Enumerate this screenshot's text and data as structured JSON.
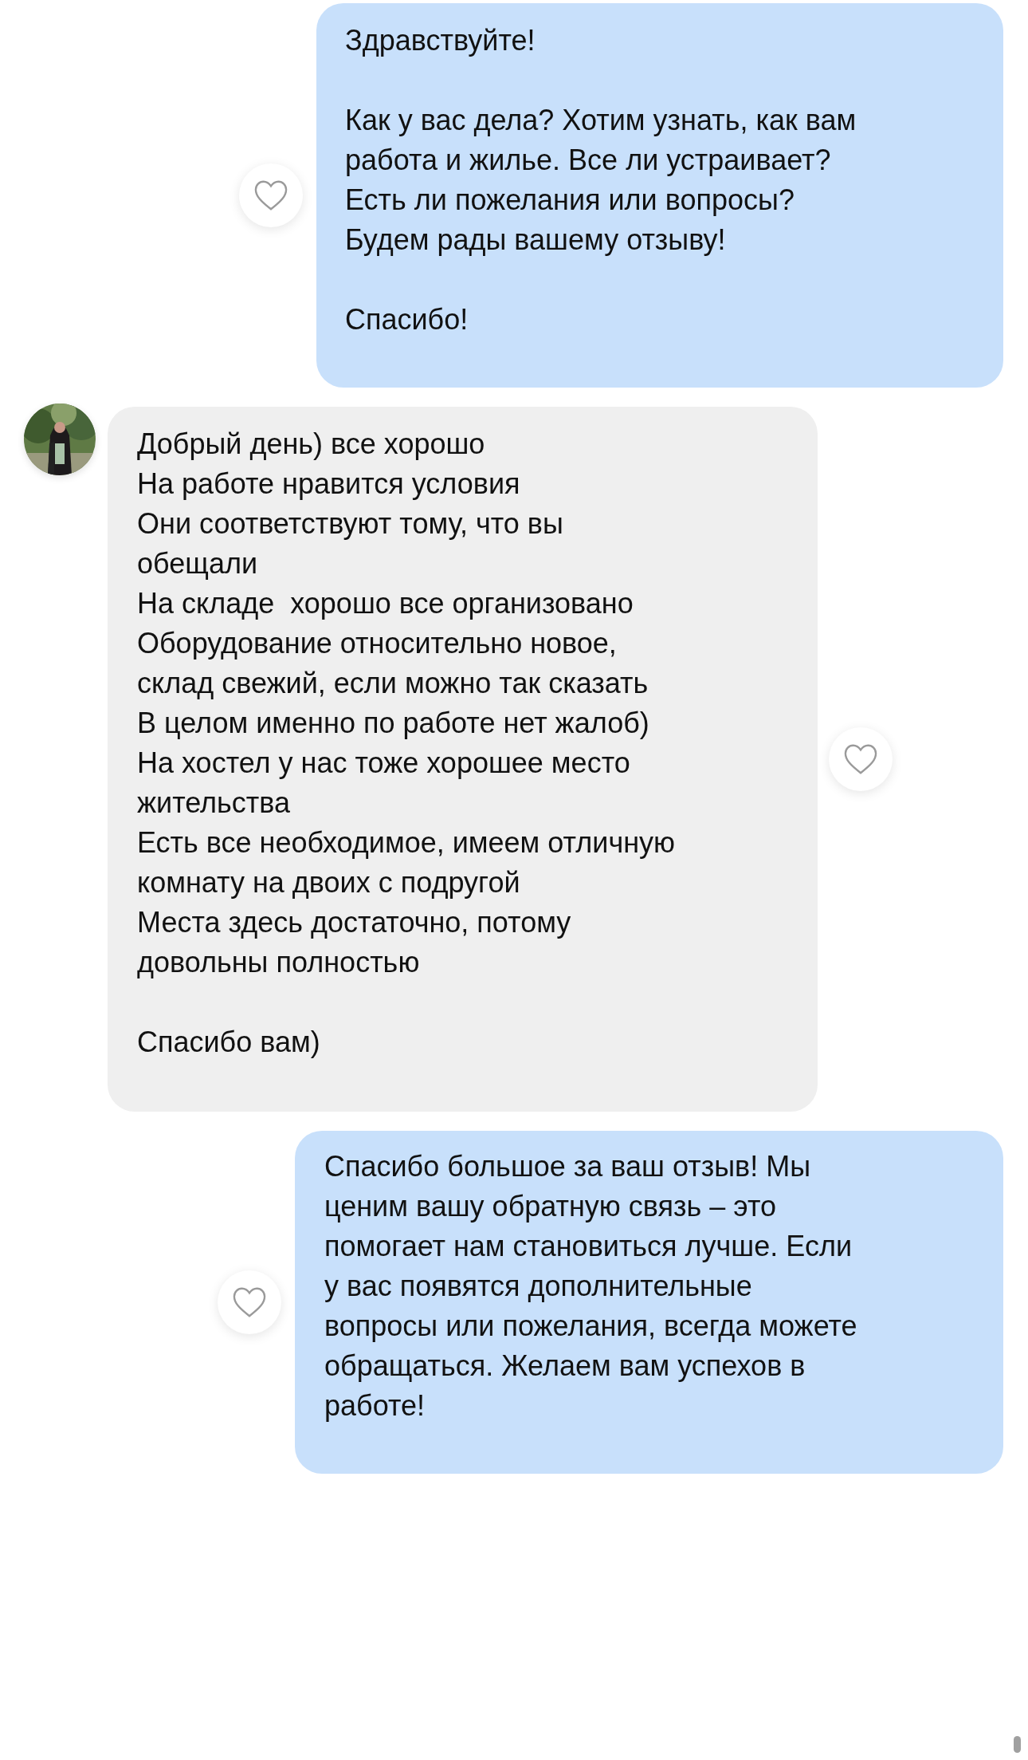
{
  "messages": [
    {
      "kind": "outgoing",
      "text": "Здравствуйте!\n\nКак у вас дела? Хотим узнать, как вам\nработа и жилье. Все ли устраивает?\nЕсть ли пожелания или вопросы?\nБудем рады вашему отзыву!\n\nСпасибо!"
    },
    {
      "kind": "incoming",
      "text": "Добрый день) все хорошо\nНа работе нравится условия\nОни соответствуют тому, что вы\nобещали\nНа складе  хорошо все организовано\nОборудование относительно новое,\nсклад свежий, если можно так сказать\nВ целом именно по работе нет жалоб)\nНа хостел у нас тоже хорошее место\nжительства\nЕсть все необходимое, имеем отличную\nкомнату на двоих с подругой\nМеста здесь достаточно, потому\nдовольны полностью\n\nСпасибо вам)"
    },
    {
      "kind": "outgoing",
      "text": "Спасибо большое за ваш отзыв! Мы\nценим вашу обратную связь – это\nпомогает нам становиться лучше. Если\nу вас появятся дополнительные\nвопросы или пожелания, всегда можете\nобращаться. Желаем вам успехов в\nработе!"
    }
  ]
}
